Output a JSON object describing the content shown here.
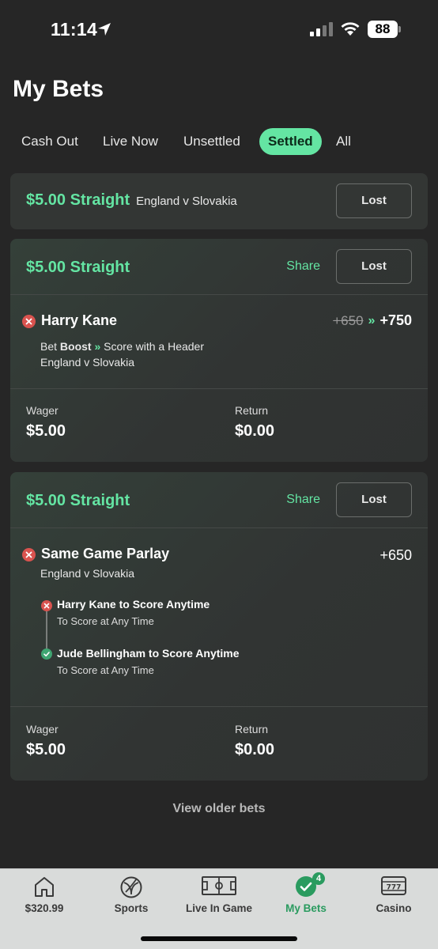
{
  "status_bar": {
    "time": "11:14",
    "battery": "88"
  },
  "page_title": "My Bets",
  "filter_tabs": [
    {
      "label": "Cash Out"
    },
    {
      "label": "Live Now"
    },
    {
      "label": "Unsettled"
    },
    {
      "label": "Settled",
      "active": true
    },
    {
      "label": "All"
    }
  ],
  "bets": [
    {
      "title": "$5.00 Straight",
      "event": "England v Slovakia",
      "status": "Lost"
    },
    {
      "title": "$5.00 Straight",
      "share_label": "Share",
      "status": "Lost",
      "selection": "Harry Kane",
      "odds_original": "+650",
      "odds_boosted": "+750",
      "boost_prefix": "Bet",
      "boost_word": "Boost",
      "market": "Score with a Header",
      "event": "England v Slovakia",
      "wager_label": "Wager",
      "wager": "$5.00",
      "return_label": "Return",
      "return": "$0.00"
    },
    {
      "title": "$5.00 Straight",
      "share_label": "Share",
      "status": "Lost",
      "selection": "Same Game Parlay",
      "odds": "+650",
      "event": "England v Slovakia",
      "legs": [
        {
          "name": "Harry Kane to Score Anytime",
          "desc": "To Score at Any Time",
          "result": "lost"
        },
        {
          "name": "Jude Bellingham to Score Anytime",
          "desc": "To Score at Any Time",
          "result": "won"
        }
      ],
      "wager_label": "Wager",
      "wager": "$5.00",
      "return_label": "Return",
      "return": "$0.00"
    }
  ],
  "view_older": "View older bets",
  "bottom_nav": [
    {
      "label": "$320.99",
      "icon": "home-icon"
    },
    {
      "label": "Sports",
      "icon": "soccer-ball-icon"
    },
    {
      "label": "Live In Game",
      "icon": "field-icon"
    },
    {
      "label": "My Bets",
      "icon": "check-circle-icon",
      "badge": "4",
      "active": true
    },
    {
      "label": "Casino",
      "icon": "slot-machine-icon"
    }
  ],
  "colors": {
    "accent": "#64e5a3",
    "background": "#262626",
    "card": "#333634",
    "nav_active": "#2a9b5f",
    "lost_red": "#d9534f"
  }
}
